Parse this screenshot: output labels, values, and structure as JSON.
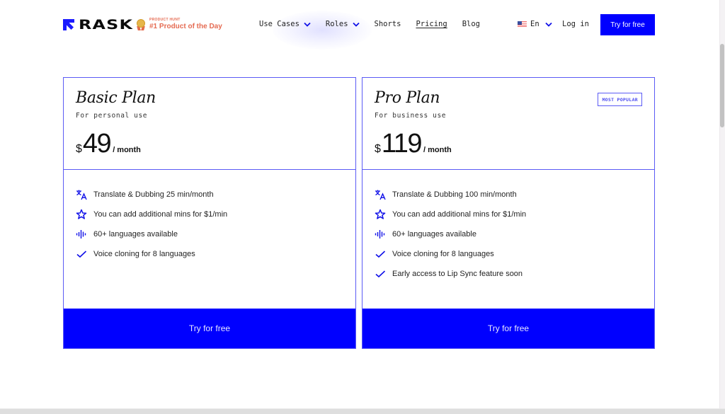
{
  "header": {
    "logo_text": "RASK",
    "product_hunt": {
      "small_label": "PRODUCT HUNT",
      "title": "#1 Product of the Day"
    },
    "nav": [
      {
        "label": "Use Cases",
        "has_dropdown": true,
        "active": false
      },
      {
        "label": "Roles",
        "has_dropdown": true,
        "active": false
      },
      {
        "label": "Shorts",
        "has_dropdown": false,
        "active": false
      },
      {
        "label": "Pricing",
        "has_dropdown": false,
        "active": true
      },
      {
        "label": "Blog",
        "has_dropdown": false,
        "active": false
      }
    ],
    "language": {
      "flag": "us-flag-icon",
      "label": "En"
    },
    "login_label": "Log in",
    "cta_label": "Try for free"
  },
  "plans": [
    {
      "name": "Basic Plan",
      "subtitle": "For personal use",
      "currency": "$",
      "price": "49",
      "period": "/ month",
      "badge": null,
      "features": [
        {
          "icon": "translate-icon",
          "text": "Translate & Dubbing 25 min/month"
        },
        {
          "icon": "star-icon",
          "text": "You can add additional mins for $1/min"
        },
        {
          "icon": "audio-wave-icon",
          "text": "60+ languages available"
        },
        {
          "icon": "check-icon",
          "text": "Voice cloning for 8 languages"
        }
      ],
      "cta_label": "Try for free"
    },
    {
      "name": "Pro Plan",
      "subtitle": "For business use",
      "currency": "$",
      "price": "119",
      "period": "/ month",
      "badge": "MOST POPULAR",
      "features": [
        {
          "icon": "translate-icon",
          "text": "Translate & Dubbing 100 min/month"
        },
        {
          "icon": "star-icon",
          "text": "You can add additional mins for $1/min"
        },
        {
          "icon": "audio-wave-icon",
          "text": "60+ languages available"
        },
        {
          "icon": "check-icon",
          "text": "Voice cloning for 8 languages"
        },
        {
          "icon": "check-icon",
          "text": "Early access to Lip Sync feature soon"
        }
      ],
      "cta_label": "Try for free"
    }
  ],
  "colors": {
    "brand_blue": "#0000ff",
    "card_border": "#5b5bf5",
    "product_hunt": "#e56b52"
  }
}
